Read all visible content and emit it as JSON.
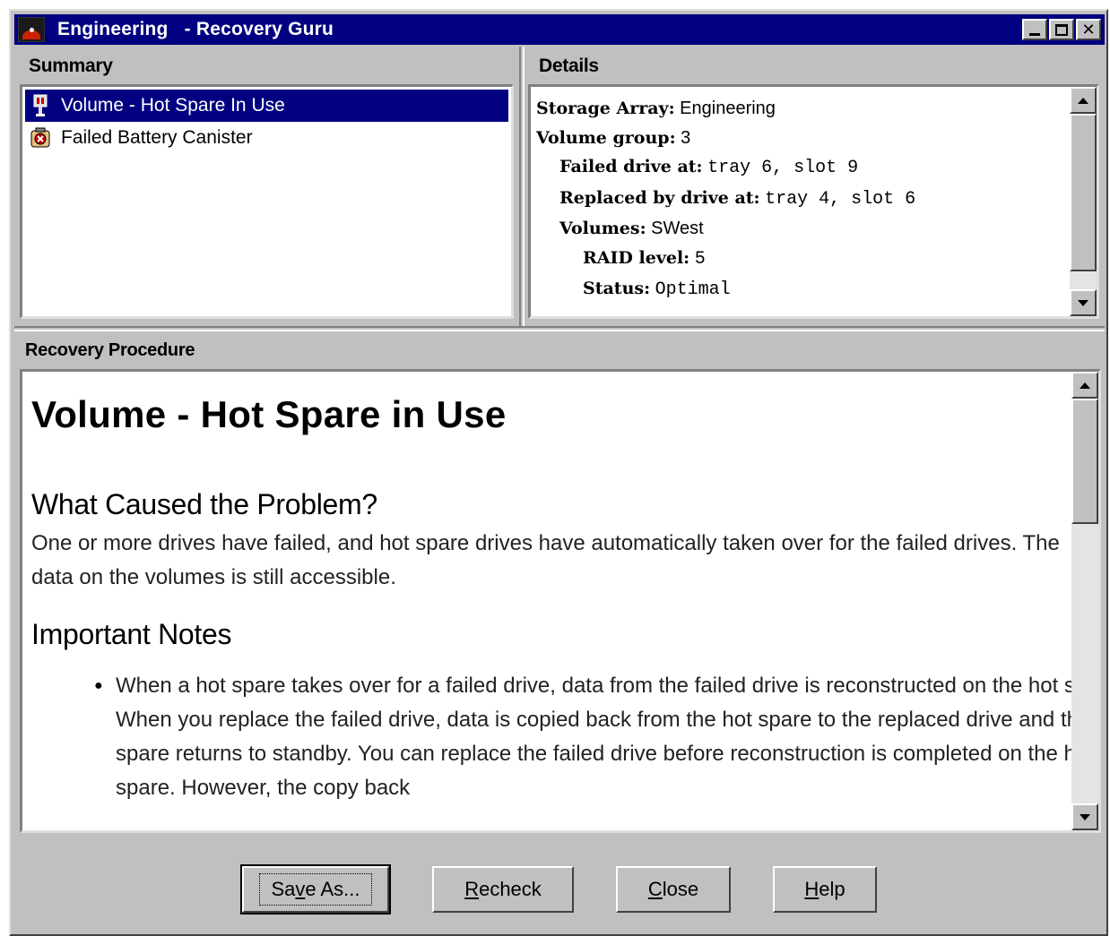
{
  "window": {
    "title": "Engineering   - Recovery Guru",
    "controls": [
      "minimize-icon",
      "maximize-icon",
      "close-icon"
    ]
  },
  "summary": {
    "title": "Summary",
    "items": [
      {
        "label": "Volume - Hot Spare In Use",
        "icon": "hot-spare-drive-icon",
        "selected": true
      },
      {
        "label": "Failed Battery Canister",
        "icon": "battery-failure-icon",
        "selected": false
      }
    ]
  },
  "details": {
    "title": "Details",
    "rows": [
      {
        "key": "Storage Array:",
        "value": "Engineering"
      },
      {
        "key": "Volume group:",
        "value": "3"
      },
      {
        "key": "Failed drive at:",
        "value": "tray 6, slot 9"
      },
      {
        "key": "Replaced by drive at:",
        "value": "tray 4, slot 6"
      },
      {
        "key": "Volumes:",
        "value": "SWest"
      },
      {
        "key": "RAID level:",
        "value": "5"
      },
      {
        "key": "Status:",
        "value": "Optimal"
      }
    ]
  },
  "procedure": {
    "title": "Recovery Procedure",
    "heading": "Volume - Hot Spare in Use",
    "cause_heading": "What Caused the Problem?",
    "cause_text": "One or more drives have failed, and hot spare drives have automatically taken over for the failed drives. The data on the volumes is still accessible.",
    "notes_heading": "Important Notes",
    "notes": [
      "When a hot spare takes over for a failed drive, data from the failed drive is reconstructed on the hot spare. When you replace the failed drive, data is copied back from the hot spare to the replaced drive and the hot spare returns to standby. You can replace the failed drive before reconstruction is completed on the hot spare. However, the copy back"
    ]
  },
  "buttons": {
    "save_as": {
      "pre": "Sa",
      "acc": "v",
      "post": "e As..."
    },
    "recheck": {
      "pre": "",
      "acc": "R",
      "post": "echeck"
    },
    "close": {
      "pre": "",
      "acc": "C",
      "post": "lose"
    },
    "help": {
      "pre": "",
      "acc": "H",
      "post": "elp"
    }
  },
  "colors": {
    "titlebar": "#000080",
    "selection": "#000080",
    "face": "#c0c0c0"
  }
}
